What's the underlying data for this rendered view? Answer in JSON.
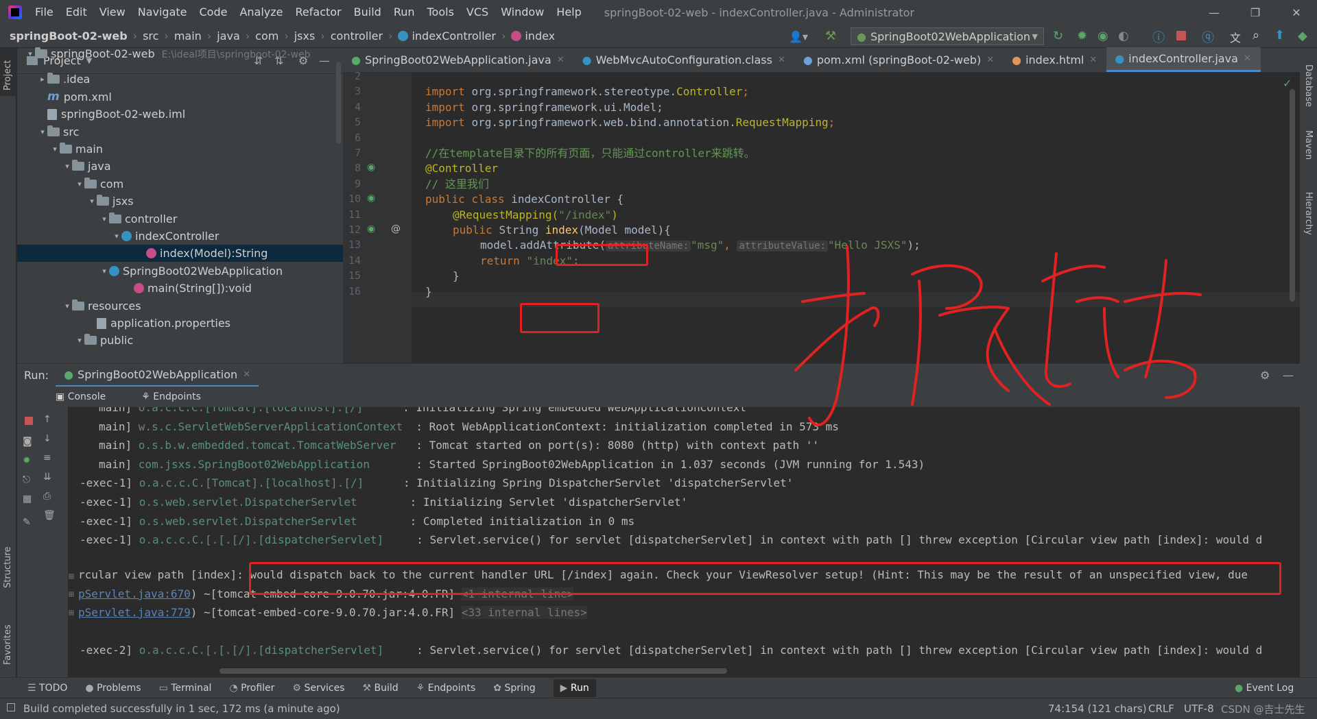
{
  "menubar": {
    "items": [
      "File",
      "Edit",
      "View",
      "Navigate",
      "Code",
      "Analyze",
      "Refactor",
      "Build",
      "Run",
      "Tools",
      "VCS",
      "Window",
      "Help"
    ],
    "title": "springBoot-02-web - indexController.java - Administrator"
  },
  "nav": {
    "crumbs": [
      "springBoot-02-web",
      "src",
      "main",
      "java",
      "com",
      "jsxs",
      "controller",
      "indexController",
      "index"
    ],
    "run_config": "SpringBoot02WebApplication"
  },
  "project": {
    "title": "Project",
    "tree": [
      {
        "label": "springBoot-02-web",
        "extra": "E:\\ideal项目\\springboot-02-web",
        "indent": 0,
        "arrow": "▾",
        "type": "folder"
      },
      {
        "label": ".idea",
        "indent": 1,
        "arrow": "▸",
        "type": "folder"
      },
      {
        "label": "pom.xml",
        "indent": 1,
        "arrow": "",
        "type": "maven"
      },
      {
        "label": "springBoot-02-web.iml",
        "indent": 1,
        "arrow": "",
        "type": "file"
      },
      {
        "label": "src",
        "indent": 1,
        "arrow": "▾",
        "type": "folder"
      },
      {
        "label": "main",
        "indent": 2,
        "arrow": "▾",
        "type": "folder"
      },
      {
        "label": "java",
        "indent": 3,
        "arrow": "▾",
        "type": "folder"
      },
      {
        "label": "com",
        "indent": 4,
        "arrow": "▾",
        "type": "folder"
      },
      {
        "label": "jsxs",
        "indent": 5,
        "arrow": "▾",
        "type": "folder"
      },
      {
        "label": "controller",
        "indent": 6,
        "arrow": "▾",
        "type": "folder"
      },
      {
        "label": "indexController",
        "indent": 7,
        "arrow": "▾",
        "type": "class"
      },
      {
        "label": "index(Model):String",
        "indent": 9,
        "arrow": "",
        "type": "method",
        "selected": true
      },
      {
        "label": "SpringBoot02WebApplication",
        "indent": 6,
        "arrow": "▾",
        "type": "class"
      },
      {
        "label": "main(String[]):void",
        "indent": 8,
        "arrow": "",
        "type": "method"
      },
      {
        "label": "resources",
        "indent": 3,
        "arrow": "▾",
        "type": "folder"
      },
      {
        "label": "application.properties",
        "indent": 5,
        "arrow": "",
        "type": "file"
      },
      {
        "label": "public",
        "indent": 4,
        "arrow": "▾",
        "type": "folder"
      }
    ]
  },
  "editor": {
    "tabs": [
      {
        "label": "SpringBoot02WebApplication.java",
        "active": false
      },
      {
        "label": "WebMvcAutoConfiguration.class",
        "active": false
      },
      {
        "label": "pom.xml (springBoot-02-web)",
        "active": false
      },
      {
        "label": "index.html",
        "active": false
      },
      {
        "label": "indexController.java",
        "active": true
      }
    ],
    "line_numbers": [
      "2",
      "3",
      "4",
      "5",
      "6",
      "7",
      "8",
      "9",
      "10",
      "11",
      "12",
      "13",
      "14",
      "15",
      "16"
    ],
    "code": {
      "l3a": "import ",
      "l3b": "org.springframework.stereotype.",
      "l3c": "Controller",
      "l4a": "import ",
      "l4b": "org.springframework.ui.Model;",
      "l5a": "import ",
      "l5b": "org.springframework.web.bind.annotation.",
      "l5c": "RequestMapping",
      "l7": "//在template目录下的所有页面，只能通过controller来跳转。",
      "l8": "@Controller",
      "l9": "// 这里我们",
      "l10a": "public class ",
      "l10b": "indexController {",
      "l11a": "@RequestMapping(",
      "l11b": "\"/index\"",
      "l11c": ")",
      "l12a": "public ",
      "l12b": "String ",
      "l12c": "index",
      "l12d": "(Model model){",
      "l13a": "model.addAttribute(",
      "l13hint1": "attributeName:",
      "l13s1": "\"msg\"",
      "l13c": ", ",
      "l13hint2": "attributeValue:",
      "l13s2": "\"Hello JSXS\"",
      "l13d": ");",
      "l14a": "return ",
      "l14b": "\"index\"",
      "l14c": ";",
      "l15": "}",
      "l16": "}"
    }
  },
  "run": {
    "label": "Run:",
    "tab": "SpringBoot02WebApplication",
    "console_tabs": [
      "Console",
      "Endpoints"
    ]
  },
  "console": {
    "lines": [
      {
        "a": "main] ",
        "cat": "o.a.c.c.C.[Tomcat].[localhost].[/]    ",
        "b": "  : Initializing Spring embedded WebApplicationContext"
      },
      {
        "a": "main] ",
        "cat": "w.s.c.ServletWebServerApplicationContext",
        "b": "  : Root WebApplicationContext: initialization completed in 573 ms"
      },
      {
        "a": "main] ",
        "cat": "o.s.b.w.embedded.tomcat.TomcatWebServer ",
        "b": "  : Tomcat started on port(s): 8080 (http) with context path ''"
      },
      {
        "a": "main] ",
        "cat": "com.jsxs.SpringBoot02WebApplication     ",
        "b": "  : Started SpringBoot02WebApplication in 1.037 seconds (JVM running for 1.543)"
      },
      {
        "a": "-exec-1] ",
        "cat": "o.a.c.c.C.[Tomcat].[localhost].[/]    ",
        "b": "  : Initializing Spring DispatcherServlet 'dispatcherServlet'"
      },
      {
        "a": "-exec-1] ",
        "cat": "o.s.web.servlet.DispatcherServlet      ",
        "b": "  : Initializing Servlet 'dispatcherServlet'"
      },
      {
        "a": "-exec-1] ",
        "cat": "o.s.web.servlet.DispatcherServlet      ",
        "b": "  : Completed initialization in 0 ms"
      },
      {
        "a": "-exec-1] ",
        "cat": "o.a.c.c.C.[.[.[/].[dispatcherServlet]   ",
        "b": "  : Servlet.service() for servlet [dispatcherServlet] in context with path [] threw exception [Circular view path [index]: would d"
      }
    ],
    "err_line": "rcular view path [index]: would dispatch back to the current handler URL [/index] again. Check your ViewResolver setup! (Hint: This may be the result of an unspecified view, due",
    "trace1_link": "pServlet.java:670",
    "trace1_rest": ") ~[tomcat-embed-core-9.0.70.jar:4.0.FR] ",
    "trace1_gray": "<1 internal line>",
    "trace2_link": "pServlet.java:779",
    "trace2_rest": ") ~[tomcat-embed-core-9.0.70.jar:4.0.FR] ",
    "trace2_gray": "<33 internal lines>",
    "last": {
      "a": "-exec-2] ",
      "cat": "o.a.c.c.C.[.[.[/].[dispatcherServlet]   ",
      "b": "  : Servlet.service() for servlet [dispatcherServlet] in context with path [] threw exception [Circular view path [index]: would d"
    }
  },
  "bottom_tabs": [
    "TODO",
    "Problems",
    "Terminal",
    "Profiler",
    "Services",
    "Build",
    "Endpoints",
    "Spring",
    "Run"
  ],
  "event_log": "Event Log",
  "status": {
    "message": "Build completed successfully in 1 sec, 172 ms (a minute ago)",
    "position": "74:154 (121 chars)",
    "line_sep": "CRLF",
    "encoding": "UTF-8",
    "watermark": "CSDN @吉士先生"
  },
  "side_labels": {
    "project": "Project",
    "structure": "Structure",
    "favorites": "Favorites",
    "database": "Database",
    "maven": "Maven",
    "hierarchy": "Hierarchy"
  }
}
